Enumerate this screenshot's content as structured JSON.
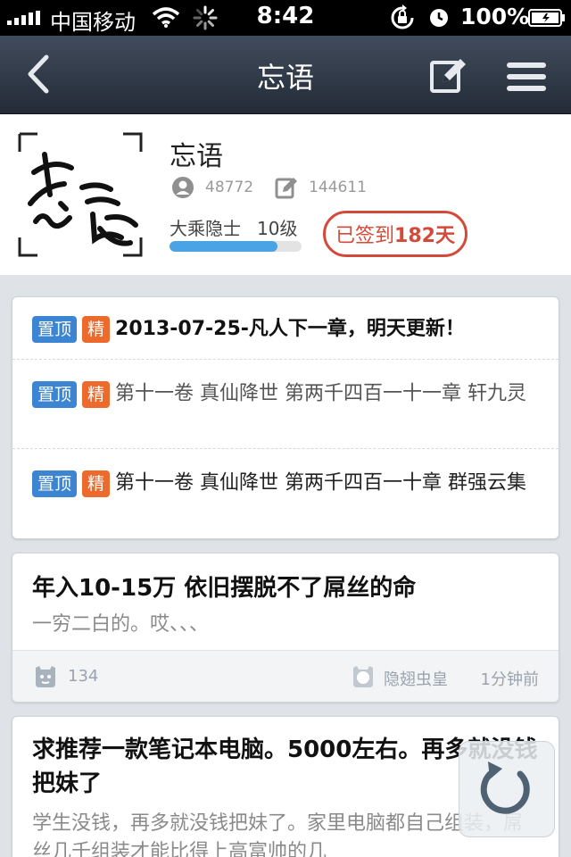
{
  "status_bar": {
    "carrier": "中国移动",
    "time": "8:42",
    "battery_percent": "100%"
  },
  "nav": {
    "title": "忘语"
  },
  "profile": {
    "name": "忘语",
    "followers": "48772",
    "posts": "144611",
    "rank": "大乘隐士",
    "level": "10级",
    "level_progress": 0.82,
    "signin_prefix": "已签到",
    "signin_days": "182天"
  },
  "pinned": [
    {
      "tag_top": "置顶",
      "tag_jing": "精",
      "text": "2013-07-25-凡人下一章，明天更新！",
      "bold": true
    },
    {
      "tag_top": "置顶",
      "tag_jing": "精",
      "text": "第十一卷 真仙降世 第两千四百一十一章 轩九灵",
      "bold": false
    },
    {
      "tag_top": "置顶",
      "tag_jing": "精",
      "text": "第十一卷 真仙降世 第两千四百一十章 群强云集",
      "bold": false
    }
  ],
  "posts": [
    {
      "title": "年入10-15万  依旧摆脱不了屌丝的命",
      "body": "一穷二白的。哎、、、",
      "comments": "134",
      "author": "隐翅虫皇",
      "time": "1分钟前"
    },
    {
      "title": "求推荐一款笔记本电脑。5000左右。再多就没钱把妹了",
      "body": "学生没钱，再多就没钱把妹了。家里电脑都自己组装，屌丝几千组装才能比得上高富帅的几"
    }
  ],
  "colors": {
    "nav_bg": "#2f3845",
    "accent_blue": "#3c85d2",
    "tag_orange": "#ec6a2b",
    "signin_red": "#d44a3a",
    "progress_blue": "#4aa3e4"
  }
}
